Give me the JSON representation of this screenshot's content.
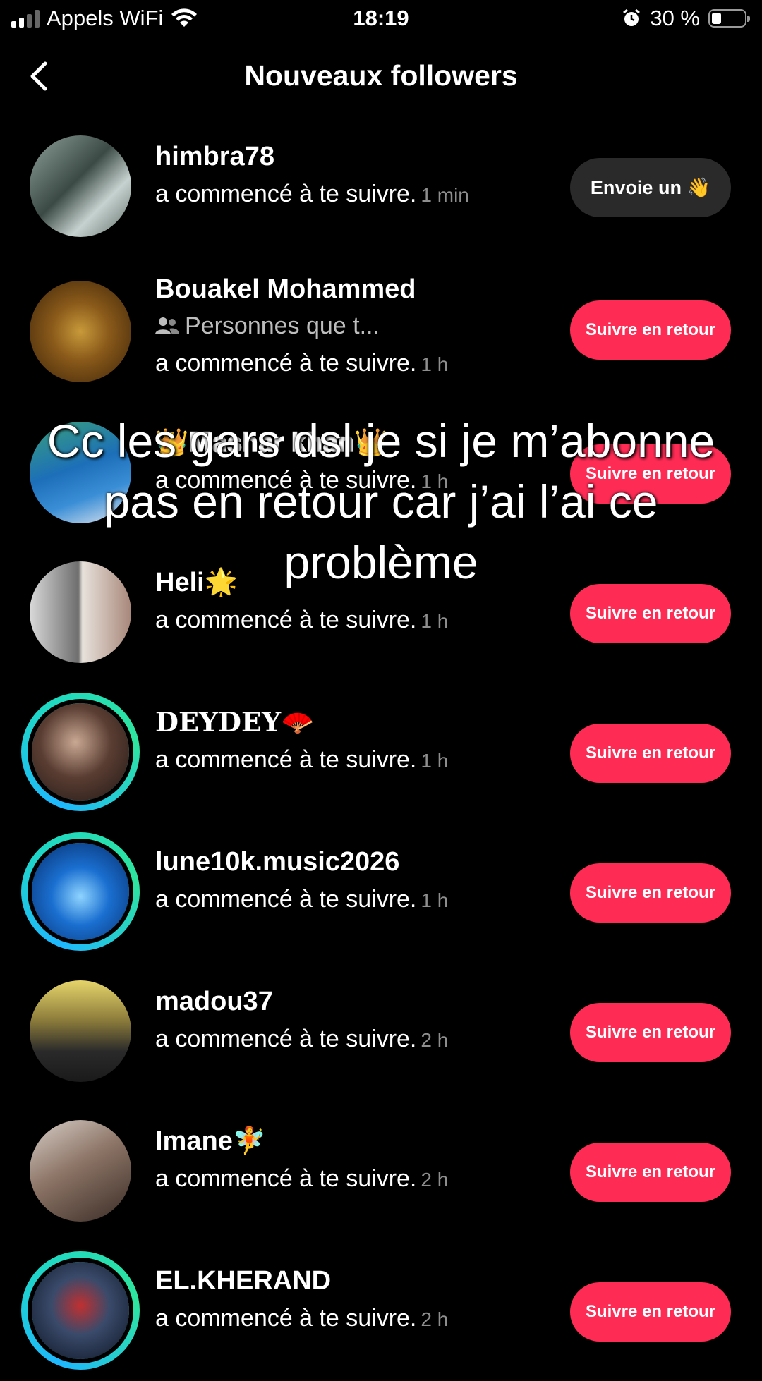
{
  "status_bar": {
    "carrier": "Appels WiFi",
    "time": "18:19",
    "battery_percent": "30 %",
    "battery_level": 0.3
  },
  "header": {
    "title": "Nouveaux followers"
  },
  "followers": [
    {
      "name": "himbra78",
      "action": "a commencé à te suivre.",
      "time": "1 min",
      "button": "Envoie un 👋",
      "button_style": "dark"
    },
    {
      "name": "Bouakel Mohammed",
      "sub": "Personnes que t...",
      "action": "a commencé à te suivre.",
      "time": "1 h",
      "button": "Suivre en retour"
    },
    {
      "name": "👑𝐌𝐚𝐬𝐡𝐚𝐫 𝐤𝐡𝐚𝐧👑",
      "action": "a commencé à te suivre.",
      "time": "1 h",
      "button": "Suivre en retour"
    },
    {
      "name": "Heli🌟",
      "action": "a commencé à te suivre.",
      "time": "1 h",
      "button": "Suivre en retour"
    },
    {
      "name": "𝐃𝐄𝐘𝐃𝐄𝐘🪭",
      "action": "a commencé à te suivre.",
      "time": "1 h",
      "button": "Suivre en retour"
    },
    {
      "name": "lune10k.music2026",
      "action": "a commencé à te suivre.",
      "time": "1 h",
      "button": "Suivre en retour"
    },
    {
      "name": "madou37",
      "action": "a commencé à te suivre.",
      "time": "2 h",
      "button": "Suivre en retour"
    },
    {
      "name": "Imane🧚",
      "action": "a commencé à te suivre.",
      "time": "2 h",
      "button": "Suivre en retour"
    },
    {
      "name": "EL.KHERAND",
      "action": "a commencé à te suivre.",
      "time": "2 h",
      "button": "Suivre en retour"
    }
  ],
  "caption_overlay": "Cc les gars dsl je si je m’abonne pas en retour car j’ai l’ai ce problème",
  "colors": {
    "accent": "#fe2c55",
    "background": "#000000",
    "ring": "#1fd8c4"
  },
  "icons": [
    "signal-icon",
    "wifi-icon",
    "alarm-icon",
    "battery-icon",
    "back-chevron-icon",
    "friends-icon"
  ]
}
